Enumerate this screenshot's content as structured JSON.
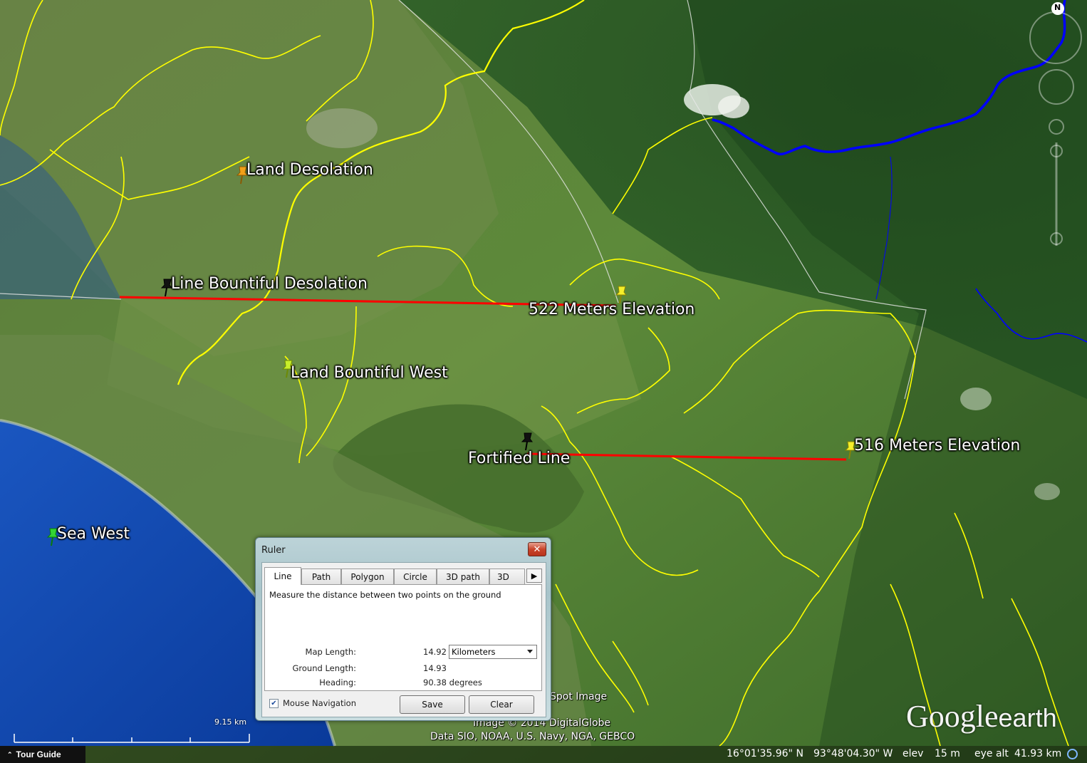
{
  "colors": {
    "measure_line": "#ff0000",
    "boundary_line": "#ffff00",
    "river_line": "#0000ff"
  },
  "placemarks": {
    "land_desolation": "Land Desolation",
    "line_bountiful_desolation": "Line Bountiful Desolation",
    "elevation_522": "522 Meters Elevation",
    "land_bountiful_west": "Land Bountiful West",
    "fortified_line": "Fortified Line",
    "elevation_516": "516 Meters Elevation",
    "sea_west": "Sea West"
  },
  "pin_icons": {
    "land_desolation": "orange-pushpin-icon",
    "line_bountiful_desolation": "black-pushpin-icon",
    "elevation_522": "yellow-pushpin-icon",
    "land_bountiful_west": "yellow-green-pushpin-icon",
    "fortified_line": "black-pushpin-icon",
    "elevation_516": "yellow-pushpin-icon",
    "sea_west": "green-pushpin-icon"
  },
  "attribution": {
    "spot_image": "Spot Image",
    "copyright": "Image © 2014 DigitalGlobe",
    "data_sources": "Data SIO, NOAA, U.S. Navy, NGA, GEBCO"
  },
  "scale_bar": {
    "label": "9.15 km"
  },
  "logo": {
    "google": "Google",
    "earth": "earth"
  },
  "compass": {
    "north": "N"
  },
  "status": {
    "tour_guide": "Tour Guide",
    "latitude": "16°01'35.96\" N",
    "longitude": "93°48'04.30\" W",
    "elev_label": "elev",
    "elev_value": "15 m",
    "eye_alt_label": "eye alt",
    "eye_alt_value": "41.93 km"
  },
  "ruler": {
    "title": "Ruler",
    "close_label": "✕",
    "tabs": [
      "Line",
      "Path",
      "Polygon",
      "Circle",
      "3D path",
      "3D"
    ],
    "active_tab": "Line",
    "description": "Measure the distance between two points on the ground",
    "map_length_label": "Map Length:",
    "map_length_value": "14.92",
    "units_selected": "Kilometers",
    "ground_length_label": "Ground Length:",
    "ground_length_value": "14.93",
    "heading_label": "Heading:",
    "heading_value": "90.38 degrees",
    "mouse_navigation_label": "Mouse Navigation",
    "mouse_navigation_checked": true,
    "save_label": "Save",
    "clear_label": "Clear"
  }
}
